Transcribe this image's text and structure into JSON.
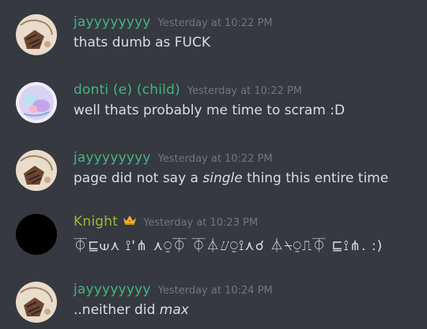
{
  "colors": {
    "background": "#36393f",
    "message_text": "#dcddde",
    "timestamp": "#72767d",
    "jay_name": "#43b581",
    "donti_name": "#43b581",
    "knight_name": "#9bbb3c"
  },
  "messages": [
    {
      "author": "jayyyyyyyy",
      "timestamp": "Yesterday at 10:22 PM",
      "text": "thats dumb as FUCK",
      "avatar_icon": "sketch-avatar"
    },
    {
      "author": "donti (e) (child)",
      "timestamp": "Yesterday at 10:22 PM",
      "text": "well thats probably me time to scram :D",
      "avatar_icon": "pastel-art-avatar"
    },
    {
      "author": "jayyyyyyyy",
      "timestamp": "Yesterday at 10:22 PM",
      "text_before": "page did not say a ",
      "text_em": "single",
      "text_after": " thing this entire time",
      "avatar_icon": "sketch-avatar"
    },
    {
      "author": "Knight",
      "badge_icon": "crown-icon",
      "timestamp": "Yesterday at 10:23 PM",
      "text": "⏁⊑⟒⋏ ⟟'⋔ ⋏⍜⏁ ⏁⏃⌰⍜⟟⋏☌ ⏃⍀⍜⎍⏁ ⊑⟟⋔. :)",
      "avatar_icon": "black-circle-avatar"
    },
    {
      "author": "jayyyyyyyy",
      "timestamp": "Yesterday at 10:24 PM",
      "text_before": "..neither did ",
      "text_em": "max",
      "avatar_icon": "sketch-avatar"
    }
  ]
}
